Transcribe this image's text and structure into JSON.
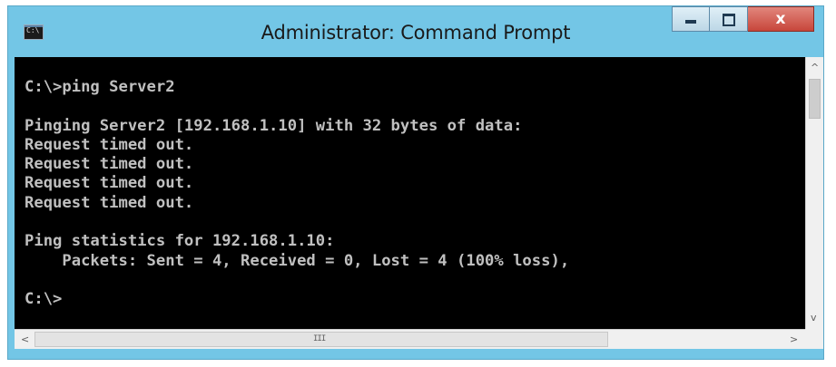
{
  "window": {
    "title": "Administrator: Command Prompt",
    "app_icon_text": "C:\\",
    "controls": {
      "minimize": "minimize",
      "maximize": "maximize",
      "close": "x"
    },
    "frame_color": "#73c6e6",
    "close_color": "#c7463b"
  },
  "console": {
    "background": "#000000",
    "foreground": "#c0c0c0",
    "text": "C:\\>ping Server2\n\nPinging Server2 [192.168.1.10] with 32 bytes of data:\nRequest timed out.\nRequest timed out.\nRequest timed out.\nRequest timed out.\n\nPing statistics for 192.168.1.10:\n    Packets: Sent = 4, Received = 0, Lost = 4 (100% loss),\n\nC:\\>"
  },
  "scrollbars": {
    "up_arrow": "^",
    "down_arrow": "v",
    "left_arrow": "<",
    "right_arrow": ">",
    "grip": "III"
  },
  "icons": [
    "cmd-app-icon",
    "minimize-icon",
    "maximize-icon",
    "close-icon",
    "scroll-up-icon",
    "scroll-down-icon",
    "scroll-left-icon",
    "scroll-right-icon"
  ]
}
